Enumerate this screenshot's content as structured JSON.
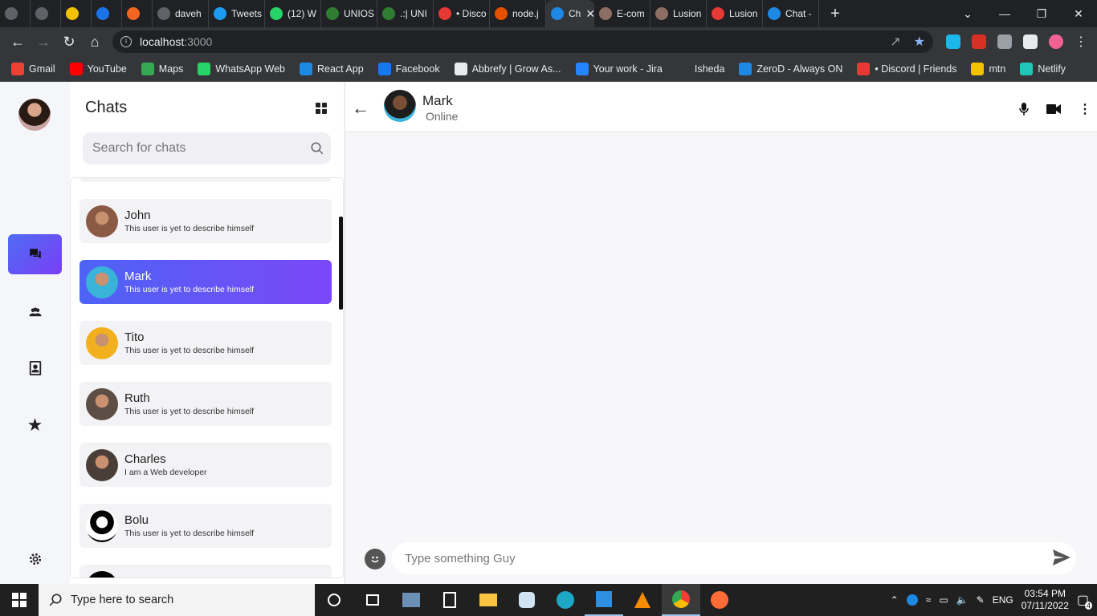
{
  "browser": {
    "tabs": [
      {
        "label": "",
        "color": "#5f6368"
      },
      {
        "label": "",
        "color": "#5f6368"
      },
      {
        "label": "",
        "color": "#f2c200"
      },
      {
        "label": "",
        "color": "#1a73e8"
      },
      {
        "label": "",
        "color": "#f26522"
      },
      {
        "label": "daveh",
        "color": "#5f6368"
      },
      {
        "label": "Tweets",
        "color": "#1d9bf0"
      },
      {
        "label": "(12) W",
        "color": "#25d366"
      },
      {
        "label": "UNIOS",
        "color": "#2e7d32"
      },
      {
        "label": ".:| UNI",
        "color": "#2e7d32"
      },
      {
        "label": "• Disco",
        "color": "#e53935"
      },
      {
        "label": "node.j",
        "color": "#e65100"
      },
      {
        "label": "Ch",
        "color": "#1e88e5",
        "active": true
      },
      {
        "label": "E-com",
        "color": "#8d6e63"
      },
      {
        "label": "Lusion",
        "color": "#8d6e63"
      },
      {
        "label": "Lusion",
        "color": "#e53935"
      },
      {
        "label": "Chat -",
        "color": "#1e88e5"
      }
    ],
    "url_host": "localhost",
    "url_port": ":3000",
    "bookmarks": [
      {
        "label": "Gmail",
        "color": "#ea4335"
      },
      {
        "label": "YouTube",
        "color": "#ff0000"
      },
      {
        "label": "Maps",
        "color": "#34a853"
      },
      {
        "label": "WhatsApp Web",
        "color": "#25d366"
      },
      {
        "label": "React App",
        "color": "#1e88e5"
      },
      {
        "label": "Facebook",
        "color": "#1877f2"
      },
      {
        "label": "Abbrefy | Grow As...",
        "color": "#e8eaed"
      },
      {
        "label": "Your work - Jira",
        "color": "#2684ff"
      },
      {
        "label": "Isheda",
        "color": "#35363a"
      },
      {
        "label": "ZeroD - Always ON",
        "color": "#1e88e5"
      },
      {
        "label": "• Discord | Friends",
        "color": "#e53935"
      },
      {
        "label": "mtn",
        "color": "#f2c200"
      },
      {
        "label": "Netlify",
        "color": "#20c6b7"
      }
    ]
  },
  "app": {
    "chats_title": "Chats",
    "search_placeholder": "Search for chats",
    "contacts": [
      {
        "name": "John",
        "desc": "This user is yet to describe himself",
        "color": "#8a5a44"
      },
      {
        "name": "Mark",
        "desc": "This user is yet to describe himself",
        "color": "#3ab3d9",
        "selected": true
      },
      {
        "name": "Tito",
        "desc": "This user is yet to describe himself",
        "color": "#f2b01e"
      },
      {
        "name": "Ruth",
        "desc": "This user is yet to describe himself",
        "color": "#5d4e45"
      },
      {
        "name": "Charles",
        "desc": "I am a Web developer",
        "color": "#4a3f38"
      },
      {
        "name": "Bolu",
        "desc": "This user is yet to describe himself",
        "color": "#000000"
      }
    ],
    "conversation": {
      "name": "Mark",
      "status": "Online",
      "message_placeholder": "Type something Guy"
    }
  },
  "taskbar": {
    "search_placeholder": "Type here to search",
    "language": "ENG",
    "time": "03:54 PM",
    "date": "07/11/2022",
    "notifications": "4"
  }
}
